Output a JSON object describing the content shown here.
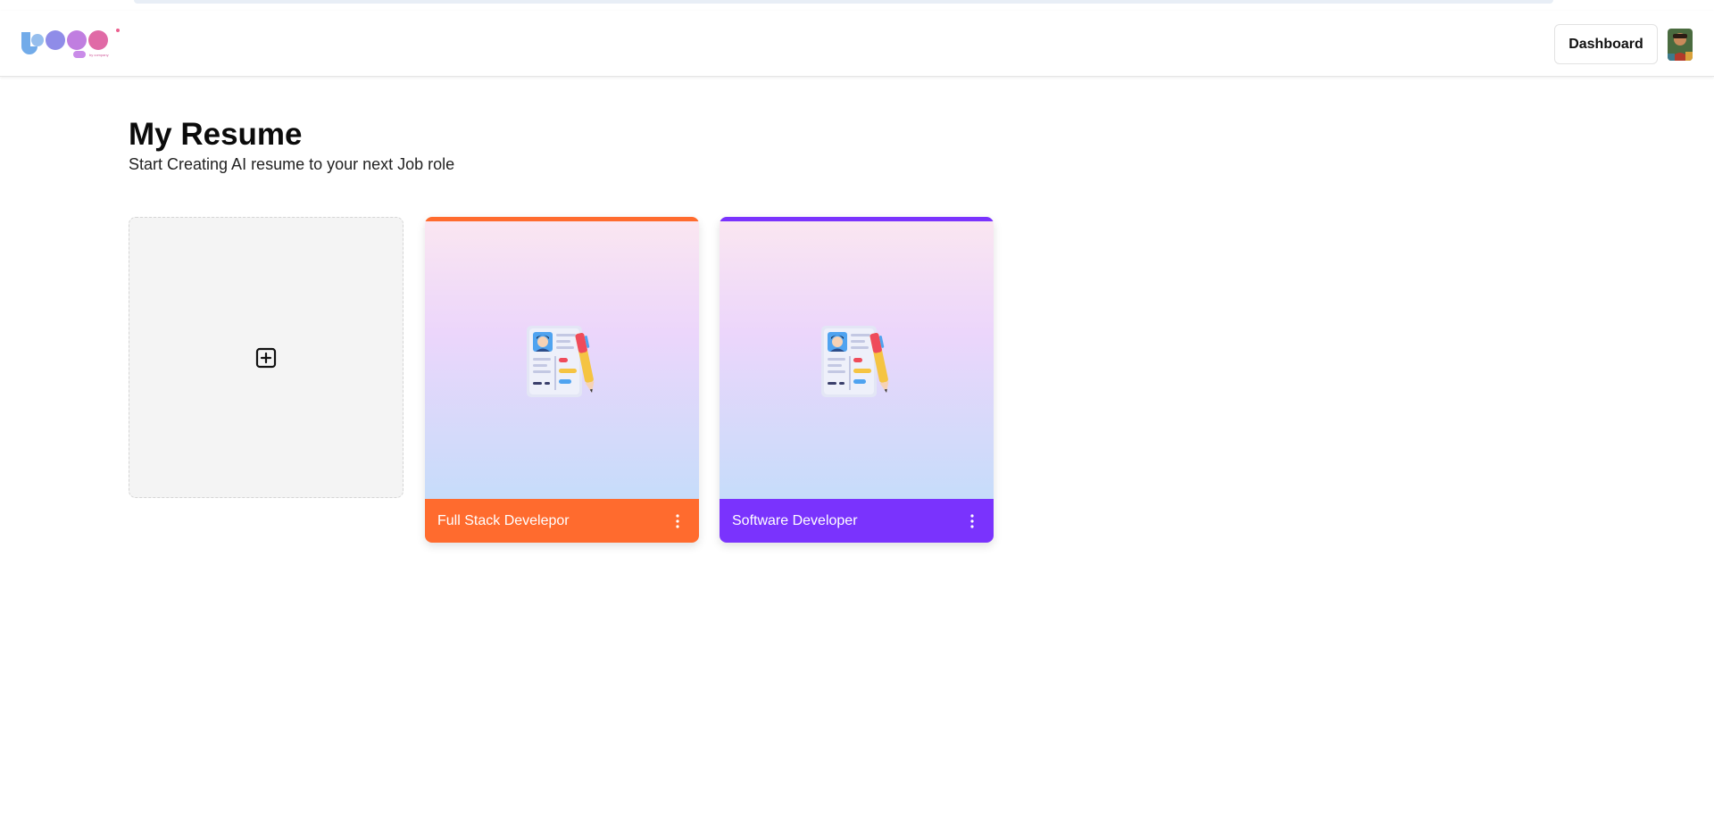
{
  "header": {
    "logo_alt": "Logo",
    "logo_tagline": "by company",
    "dashboard_label": "Dashboard",
    "avatar_icon": "user-avatar"
  },
  "page": {
    "title": "My Resume",
    "subtitle": "Start Creating AI resume to your next Job role"
  },
  "add_card": {
    "icon": "plus-square-icon"
  },
  "resumes": [
    {
      "title": "Full Stack Develepor",
      "accent": "#ff6b2e",
      "icon": "resume-document-icon"
    },
    {
      "title": "Software Developer",
      "accent": "#7a33fd",
      "icon": "resume-document-icon"
    }
  ],
  "colors": {
    "card_gradient_top": "#fae6f1",
    "card_gradient_bottom": "#c6dcfa",
    "add_card_bg": "#f4f4f4"
  }
}
